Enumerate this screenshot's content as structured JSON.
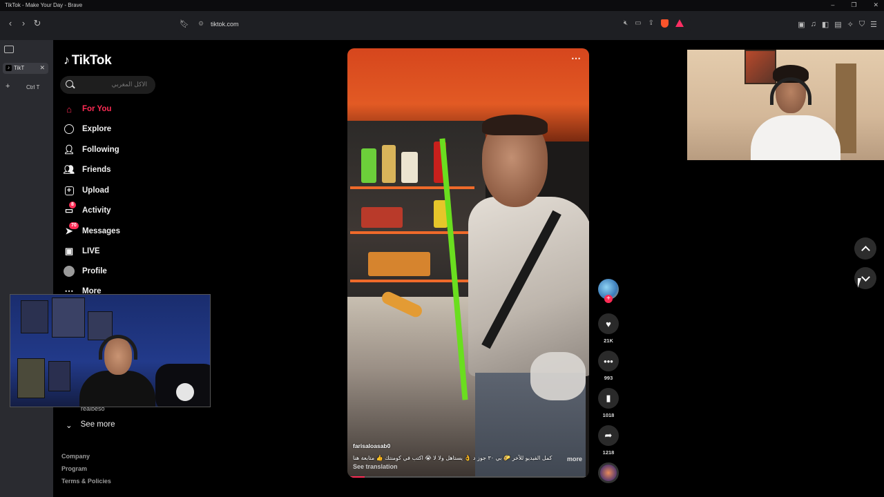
{
  "browser": {
    "window_title": "TikTok - Make Your Day - Brave",
    "url": "tiktok.com",
    "tab_label": "TikT",
    "new_tab_label": "+",
    "shortcut_hint": "Ctrl  T",
    "window_controls": [
      "–",
      "❐",
      "✕"
    ]
  },
  "tiktok": {
    "logo_text": "TikTok",
    "search": {
      "placeholder": "الأكل المغربي",
      "value": ""
    },
    "nav": [
      {
        "label": "For You",
        "icon": "home-icon",
        "active": true
      },
      {
        "label": "Explore",
        "icon": "compass-icon"
      },
      {
        "label": "Following",
        "icon": "following-icon"
      },
      {
        "label": "Friends",
        "icon": "friends-icon"
      },
      {
        "label": "Upload",
        "icon": "upload-icon"
      },
      {
        "label": "Activity",
        "icon": "activity-icon",
        "badge": "8"
      },
      {
        "label": "Messages",
        "icon": "messages-icon",
        "badge": "70"
      },
      {
        "label": "LIVE",
        "icon": "live-icon"
      },
      {
        "label": "Profile",
        "icon": "profile-icon"
      },
      {
        "label": "More",
        "icon": "more-icon"
      }
    ],
    "following_user_partial": "realbeso",
    "see_more": "See more",
    "footer": [
      "Company",
      "Program",
      "Terms & Policies"
    ]
  },
  "video": {
    "author": "farisaloasab0",
    "caption": "كمل الفيديو للآخر 🌮 بي ٣٠ جوز د 👌 يستاهل ولا لا 😭 اكتب في كومنتك 👍 متابعة هنا",
    "more_label": "more",
    "see_translation": "See translation",
    "progress": 0.07
  },
  "actions": {
    "likes": "21K",
    "comments": "993",
    "saves": "1018",
    "shares": "1218"
  },
  "colors": {
    "accent": "#fe2c55",
    "background": "#000000"
  }
}
